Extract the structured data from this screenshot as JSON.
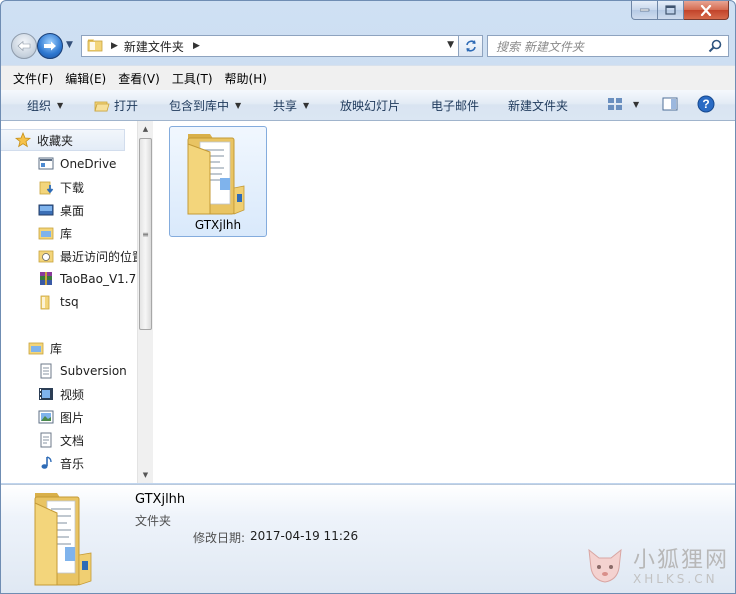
{
  "window": {
    "caption_buttons": [
      "minimize-icon",
      "maximize-icon",
      "close-icon"
    ]
  },
  "address": {
    "path": "新建文件夹",
    "search_placeholder": "搜索 新建文件夹"
  },
  "menu": {
    "items": [
      "文件(F)",
      "编辑(E)",
      "查看(V)",
      "工具(T)",
      "帮助(H)"
    ]
  },
  "commands": {
    "organize": "组织",
    "open": "打开",
    "include_in_library": "包含到库中",
    "share": "共享",
    "slideshow": "放映幻灯片",
    "email": "电子邮件",
    "new_folder": "新建文件夹"
  },
  "nav": {
    "favorites": "收藏夹",
    "favorites_items": [
      "OneDrive",
      "下载",
      "桌面",
      "库",
      "最近访问的位置",
      "TaoBao_V1.7",
      "tsq"
    ],
    "libraries": "库",
    "library_items": [
      "Subversion",
      "视频",
      "图片",
      "文档",
      "音乐"
    ]
  },
  "content": {
    "items": [
      {
        "name": "GTXjlhh"
      }
    ]
  },
  "details": {
    "name": "GTXjlhh",
    "type": "文件夹",
    "date_label": "修改日期:",
    "date_value": "2017-04-19 11:26"
  },
  "watermark": {
    "cn": "小狐狸网",
    "en": "XHLKS.CN"
  },
  "colors": {
    "accent": "#2d77d0",
    "selection": "#d9e9fb",
    "selection_border": "#84acdd",
    "close_button": "#c2432a"
  }
}
